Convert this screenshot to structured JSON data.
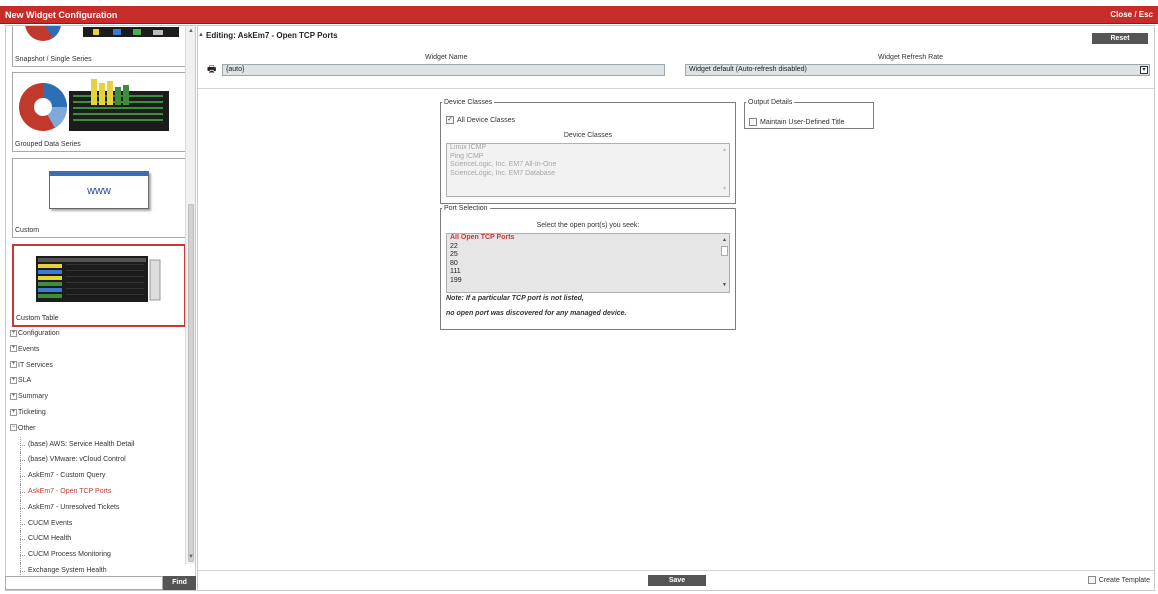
{
  "window": {
    "title": "New Widget Configuration",
    "close_label": "Close / Esc"
  },
  "sidebar": {
    "cards": [
      {
        "caption": "Snapshot / Single Series"
      },
      {
        "caption": "Grouped Data Series"
      },
      {
        "caption": "Custom",
        "thumb_text": "www"
      },
      {
        "caption": "Custom Table"
      }
    ],
    "tree": [
      {
        "label": "Configuration",
        "expander": "+"
      },
      {
        "label": "Events",
        "expander": "+"
      },
      {
        "label": "IT Services",
        "expander": "+"
      },
      {
        "label": "SLA",
        "expander": "+"
      },
      {
        "label": "Summary",
        "expander": "+"
      },
      {
        "label": "Ticketing",
        "expander": "+"
      },
      {
        "label": "Other",
        "expander": "−"
      }
    ],
    "other_items": [
      "(base) AWS: Service Health Detail",
      "(base) VMware: vCloud Control",
      "AskEm7 - Custom Query",
      "AskEm7 - Open TCP Ports",
      "AskEm7 - Unresolved Tickets",
      "CUCM Events",
      "CUCM Health",
      "CUCM Process Monitoring",
      "Exchange System Health"
    ],
    "find_label": "Find",
    "find_value": ""
  },
  "main": {
    "editing_title": "Editing: AskEm7 - Open TCP Ports",
    "reset_label": "Reset",
    "widget_name_label": "Widget Name",
    "widget_name_value": "{auto}",
    "refresh_label": "Widget Refresh Rate",
    "refresh_value": "Widget default (Auto-refresh disabled)",
    "device_classes": {
      "legend": "Device Classes",
      "all_label": "All Device Classes",
      "all_checked": true,
      "list_title": "Device Classes",
      "options": [
        "Linux ICMP",
        "Ping ICMP",
        "ScienceLogic, Inc. EM7 All-In-One",
        "ScienceLogic, Inc. EM7 Database"
      ]
    },
    "output_details": {
      "legend": "Output Details",
      "maintain_label": "Maintain User-Defined Title",
      "maintain_checked": false
    },
    "port_selection": {
      "legend": "Port Selection",
      "instruction": "Select the open port(s) you seek:",
      "options": [
        "All Open TCP Ports",
        "22",
        "25",
        "80",
        "111",
        "199"
      ],
      "selected": "All Open TCP Ports",
      "note_line1": "Note: If a particular TCP port is not listed,",
      "note_line2": "no open port was discovered for any managed device."
    },
    "save_label": "Save",
    "create_template_label": "Create Template",
    "create_template_checked": false
  },
  "colors": {
    "titlebar": "#c62c2a",
    "selection": "#c33a37",
    "button": "#555555"
  }
}
